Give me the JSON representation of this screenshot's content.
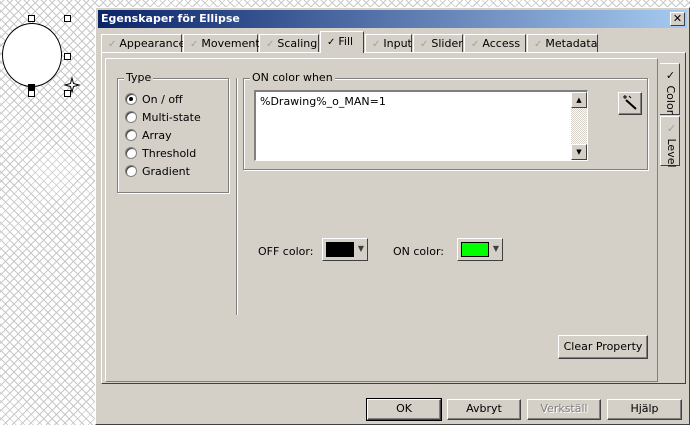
{
  "dialog": {
    "title": "Egenskaper för Ellipse",
    "close_icon": "close-icon"
  },
  "tabs": [
    {
      "label": "Appearance",
      "checked": false
    },
    {
      "label": "Movement",
      "checked": false
    },
    {
      "label": "Scaling",
      "checked": false
    },
    {
      "label": "Fill",
      "checked": true,
      "active": true
    },
    {
      "label": "Input",
      "checked": false
    },
    {
      "label": "Slider",
      "checked": false
    },
    {
      "label": "Access",
      "checked": false
    },
    {
      "label": "Metadata",
      "checked": false
    }
  ],
  "side_tabs": [
    {
      "label": "Color",
      "checked": true,
      "active": true
    },
    {
      "label": "Level",
      "checked": false
    }
  ],
  "type_group": {
    "legend": "Type",
    "options": [
      "On / off",
      "Multi-state",
      "Array",
      "Threshold",
      "Gradient"
    ],
    "selected": "On / off"
  },
  "on_color_group": {
    "legend": "ON color when",
    "expression": "%Drawing%_o_MAN=1",
    "wand_icon": "magic-wand-icon"
  },
  "off_color": {
    "label": "OFF color:",
    "color": "#000000"
  },
  "on_color": {
    "label": "ON color:",
    "color": "#00ff00"
  },
  "clear_property_label": "Clear Property",
  "footer": {
    "ok": "OK",
    "cancel": "Avbryt",
    "apply": "Verkställ",
    "help": "Hjälp"
  },
  "check_mark": "✓"
}
